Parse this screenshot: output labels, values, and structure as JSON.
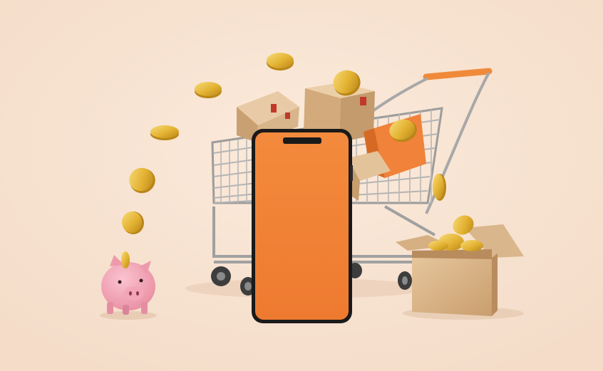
{
  "scene": {
    "background_color": "#f7e3d2",
    "phone_screen_color": "#f07f36",
    "cart_handle_color": "#f08a3a",
    "piggy_color": "#f3a4b5",
    "coin_color": "#e9bd3a",
    "box_color": "#d9b58c",
    "icons": [
      "shopping-cart-icon",
      "smartphone-icon",
      "piggy-bank-icon",
      "coin-icon",
      "cardboard-box-icon"
    ]
  }
}
